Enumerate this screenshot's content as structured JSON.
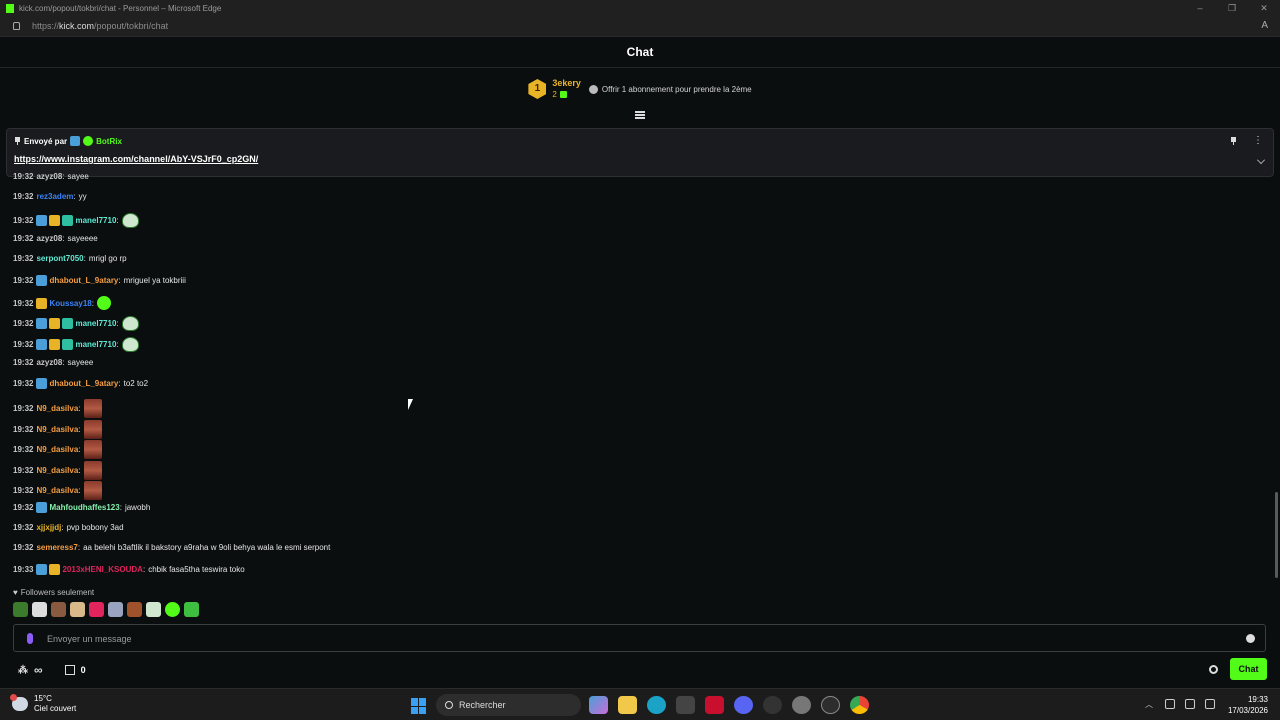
{
  "window": {
    "title": "kick.com/popout/tokbri/chat - Personnel – Microsoft Edge",
    "url_prefix": "https://",
    "url_host": "kick.com",
    "url_path": "/popout/tokbri/chat"
  },
  "chat": {
    "header": "Chat"
  },
  "leaderboard": {
    "rank": "1",
    "username": "3ekery",
    "gift_count": "2",
    "offer_text": "Offrir 1 abonnement pour prendre la 2ème"
  },
  "pinned": {
    "sent_by_label": "Envoyé par",
    "bot_name": "BotRix",
    "link": "https://www.instagram.com/channel/AbY-VSJrF0_cp2GN/"
  },
  "messages": [
    {
      "time": "19:32",
      "user": "azyz08",
      "color": "#c9c9c9",
      "badges": [],
      "text": "sayee",
      "emote": ""
    },
    {
      "time": "19:32",
      "user": "rez3adem",
      "color": "#3b82f6",
      "badges": [],
      "text": "yy",
      "emote": ""
    },
    {
      "time": "19:32",
      "user": "manel7710",
      "color": "#5eead4",
      "badges": [
        "blue",
        "gold",
        "teal"
      ],
      "text": "",
      "emote": "frog-white"
    },
    {
      "time": "19:32",
      "user": "azyz08",
      "color": "#c9c9c9",
      "badges": [],
      "text": "sayeeee",
      "emote": ""
    },
    {
      "time": "19:32",
      "user": "serpont7050",
      "color": "#5eead4",
      "badges": [],
      "text": "mrigl go rp",
      "emote": ""
    },
    {
      "time": "19:32",
      "user": "dhabout_L_9atary",
      "color": "#f59e42",
      "badges": [
        "blue"
      ],
      "text": "mriguel ya tokbriii",
      "emote": ""
    },
    {
      "time": "19:32",
      "user": "Koussay18",
      "color": "#3b82f6",
      "badges": [
        "gold"
      ],
      "text": "",
      "emote": "green"
    },
    {
      "time": "19:32",
      "user": "manel7710",
      "color": "#5eead4",
      "badges": [
        "blue",
        "gold",
        "teal"
      ],
      "text": "",
      "emote": "frog-white"
    },
    {
      "time": "19:32",
      "user": "manel7710",
      "color": "#5eead4",
      "badges": [
        "blue",
        "gold",
        "teal"
      ],
      "text": "",
      "emote": "frog-white"
    },
    {
      "time": "19:32",
      "user": "azyz08",
      "color": "#c9c9c9",
      "badges": [],
      "text": "sayeee",
      "emote": ""
    },
    {
      "time": "19:32",
      "user": "dhabout_L_9atary",
      "color": "#f59e42",
      "badges": [
        "blue"
      ],
      "text": "to2 to2",
      "emote": ""
    },
    {
      "time": "19:32",
      "user": "N9_dasilva",
      "color": "#f59e42",
      "badges": [],
      "text": "",
      "emote": "face"
    },
    {
      "time": "19:32",
      "user": "N9_dasilva",
      "color": "#f59e42",
      "badges": [],
      "text": "",
      "emote": "face"
    },
    {
      "time": "19:32",
      "user": "N9_dasilva",
      "color": "#f59e42",
      "badges": [],
      "text": "",
      "emote": "face"
    },
    {
      "time": "19:32",
      "user": "N9_dasilva",
      "color": "#f59e42",
      "badges": [],
      "text": "",
      "emote": "face"
    },
    {
      "time": "19:32",
      "user": "N9_dasilva",
      "color": "#f59e42",
      "badges": [],
      "text": "",
      "emote": "face"
    },
    {
      "time": "19:32",
      "user": "Mahfoudhaffes123",
      "color": "#86efac",
      "badges": [
        "blue"
      ],
      "text": "jawobh",
      "emote": ""
    },
    {
      "time": "19:32",
      "user": "xjjxjjdj",
      "color": "#e8b327",
      "badges": [],
      "text": "pvp bobony 3ad",
      "emote": ""
    },
    {
      "time": "19:32",
      "user": "semeress7",
      "color": "#f59e42",
      "badges": [],
      "text": "aa belehi b3aftlik il bakstory a9raha w 9oli behya wala le esmi serpont",
      "emote": ""
    },
    {
      "time": "19:33",
      "user": "2013xHENI_KSOUDA",
      "color": "#e0245e",
      "badges": [
        "blue",
        "gold"
      ],
      "text": "chbik fasa5tha teswira toko",
      "emote": ""
    }
  ],
  "followers_only": "Followers seulement",
  "input": {
    "placeholder": "Envoyer un message"
  },
  "controls": {
    "points": "0",
    "chat_button": "Chat"
  },
  "taskbar": {
    "temperature": "15°C",
    "weather": "Ciel couvert",
    "search_label": "Rechercher",
    "time": "19:33",
    "date": "17/03/2026"
  }
}
